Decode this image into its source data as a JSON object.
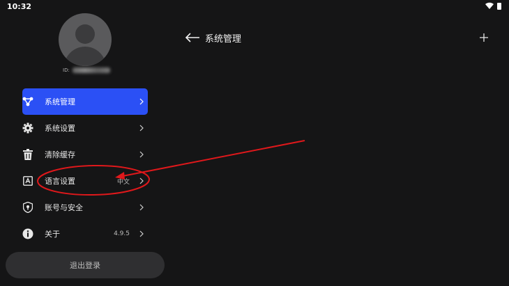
{
  "status_bar": {
    "time": "10:32"
  },
  "profile": {
    "id_label": "ID:",
    "id_value": ""
  },
  "menu": {
    "items": [
      {
        "label": "系统管理",
        "icon": "network-icon",
        "active": true,
        "value": ""
      },
      {
        "label": "系统设置",
        "icon": "gear-icon",
        "active": false,
        "value": ""
      },
      {
        "label": "清除缓存",
        "icon": "trash-icon",
        "active": false,
        "value": ""
      },
      {
        "label": "语言设置",
        "icon": "language-icon",
        "active": false,
        "value": "中文"
      },
      {
        "label": "账号与安全",
        "icon": "shield-icon",
        "active": false,
        "value": ""
      },
      {
        "label": "关于",
        "icon": "info-icon",
        "active": false,
        "value": "4.9.5"
      }
    ]
  },
  "logout_label": "退出登录",
  "header": {
    "title": "系统管理"
  },
  "colors": {
    "background": "#151516",
    "accent": "#2b50f5",
    "logout_bg": "#2f2f31",
    "annotation": "#e0181b"
  }
}
